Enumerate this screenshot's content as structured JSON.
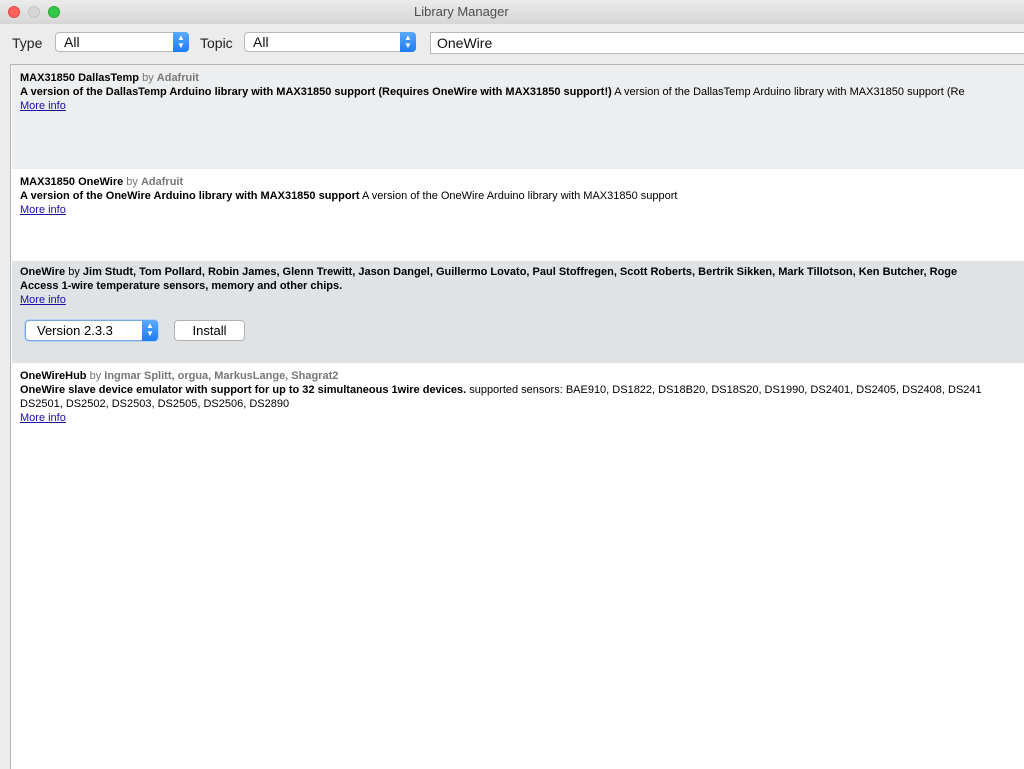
{
  "window": {
    "title": "Library Manager"
  },
  "filters": {
    "type_label": "Type",
    "type_value": "All",
    "topic_label": "Topic",
    "topic_value": "All",
    "search_value": "OneWire"
  },
  "libraries": [
    {
      "name": "MAX31850 DallasTemp",
      "by": "by",
      "authors": "Adafruit",
      "sentence": "A version of the DallasTemp Arduino library with MAX31850 support (Requires OneWire with MAX31850 support!)",
      "paragraph": "A version of the DallasTemp Arduino library with MAX31850 support (Re",
      "more_info": "More info"
    },
    {
      "name": "MAX31850 OneWire",
      "by": "by",
      "authors": "Adafruit",
      "sentence": "A version of the OneWire Arduino library with MAX31850 support",
      "paragraph": "A version of the OneWire Arduino library with MAX31850 support",
      "more_info": "More info"
    },
    {
      "name": "OneWire",
      "by": "by",
      "authors": "Jim Studt, Tom Pollard, Robin James, Glenn Trewitt, Jason Dangel, Guillermo Lovato, Paul Stoffregen, Scott Roberts, Bertrik Sikken, Mark Tillotson, Ken Butcher, Roge",
      "sentence": "Access 1-wire temperature sensors, memory and other chips.",
      "more_info": "More info",
      "version_select": "Version 2.3.3",
      "install_label": "Install"
    },
    {
      "name": "OneWireHub",
      "by": "by",
      "authors": "Ingmar Splitt, orgua, MarkusLange, Shagrat2",
      "sentence": "OneWire slave device emulator with support for up to 32 simultaneous 1wire devices.",
      "paragraph": "supported sensors: BAE910, DS1822, DS18B20, DS18S20, DS1990, DS2401, DS2405, DS2408, DS241",
      "paragraph_line2": "DS2501, DS2502, DS2503, DS2505, DS2506, DS2890",
      "more_info": "More info"
    }
  ],
  "colors": {
    "link": "#1a0dab",
    "select_accent": "#1e7bf3",
    "close": "#fc605c",
    "maximize": "#34c84a"
  }
}
